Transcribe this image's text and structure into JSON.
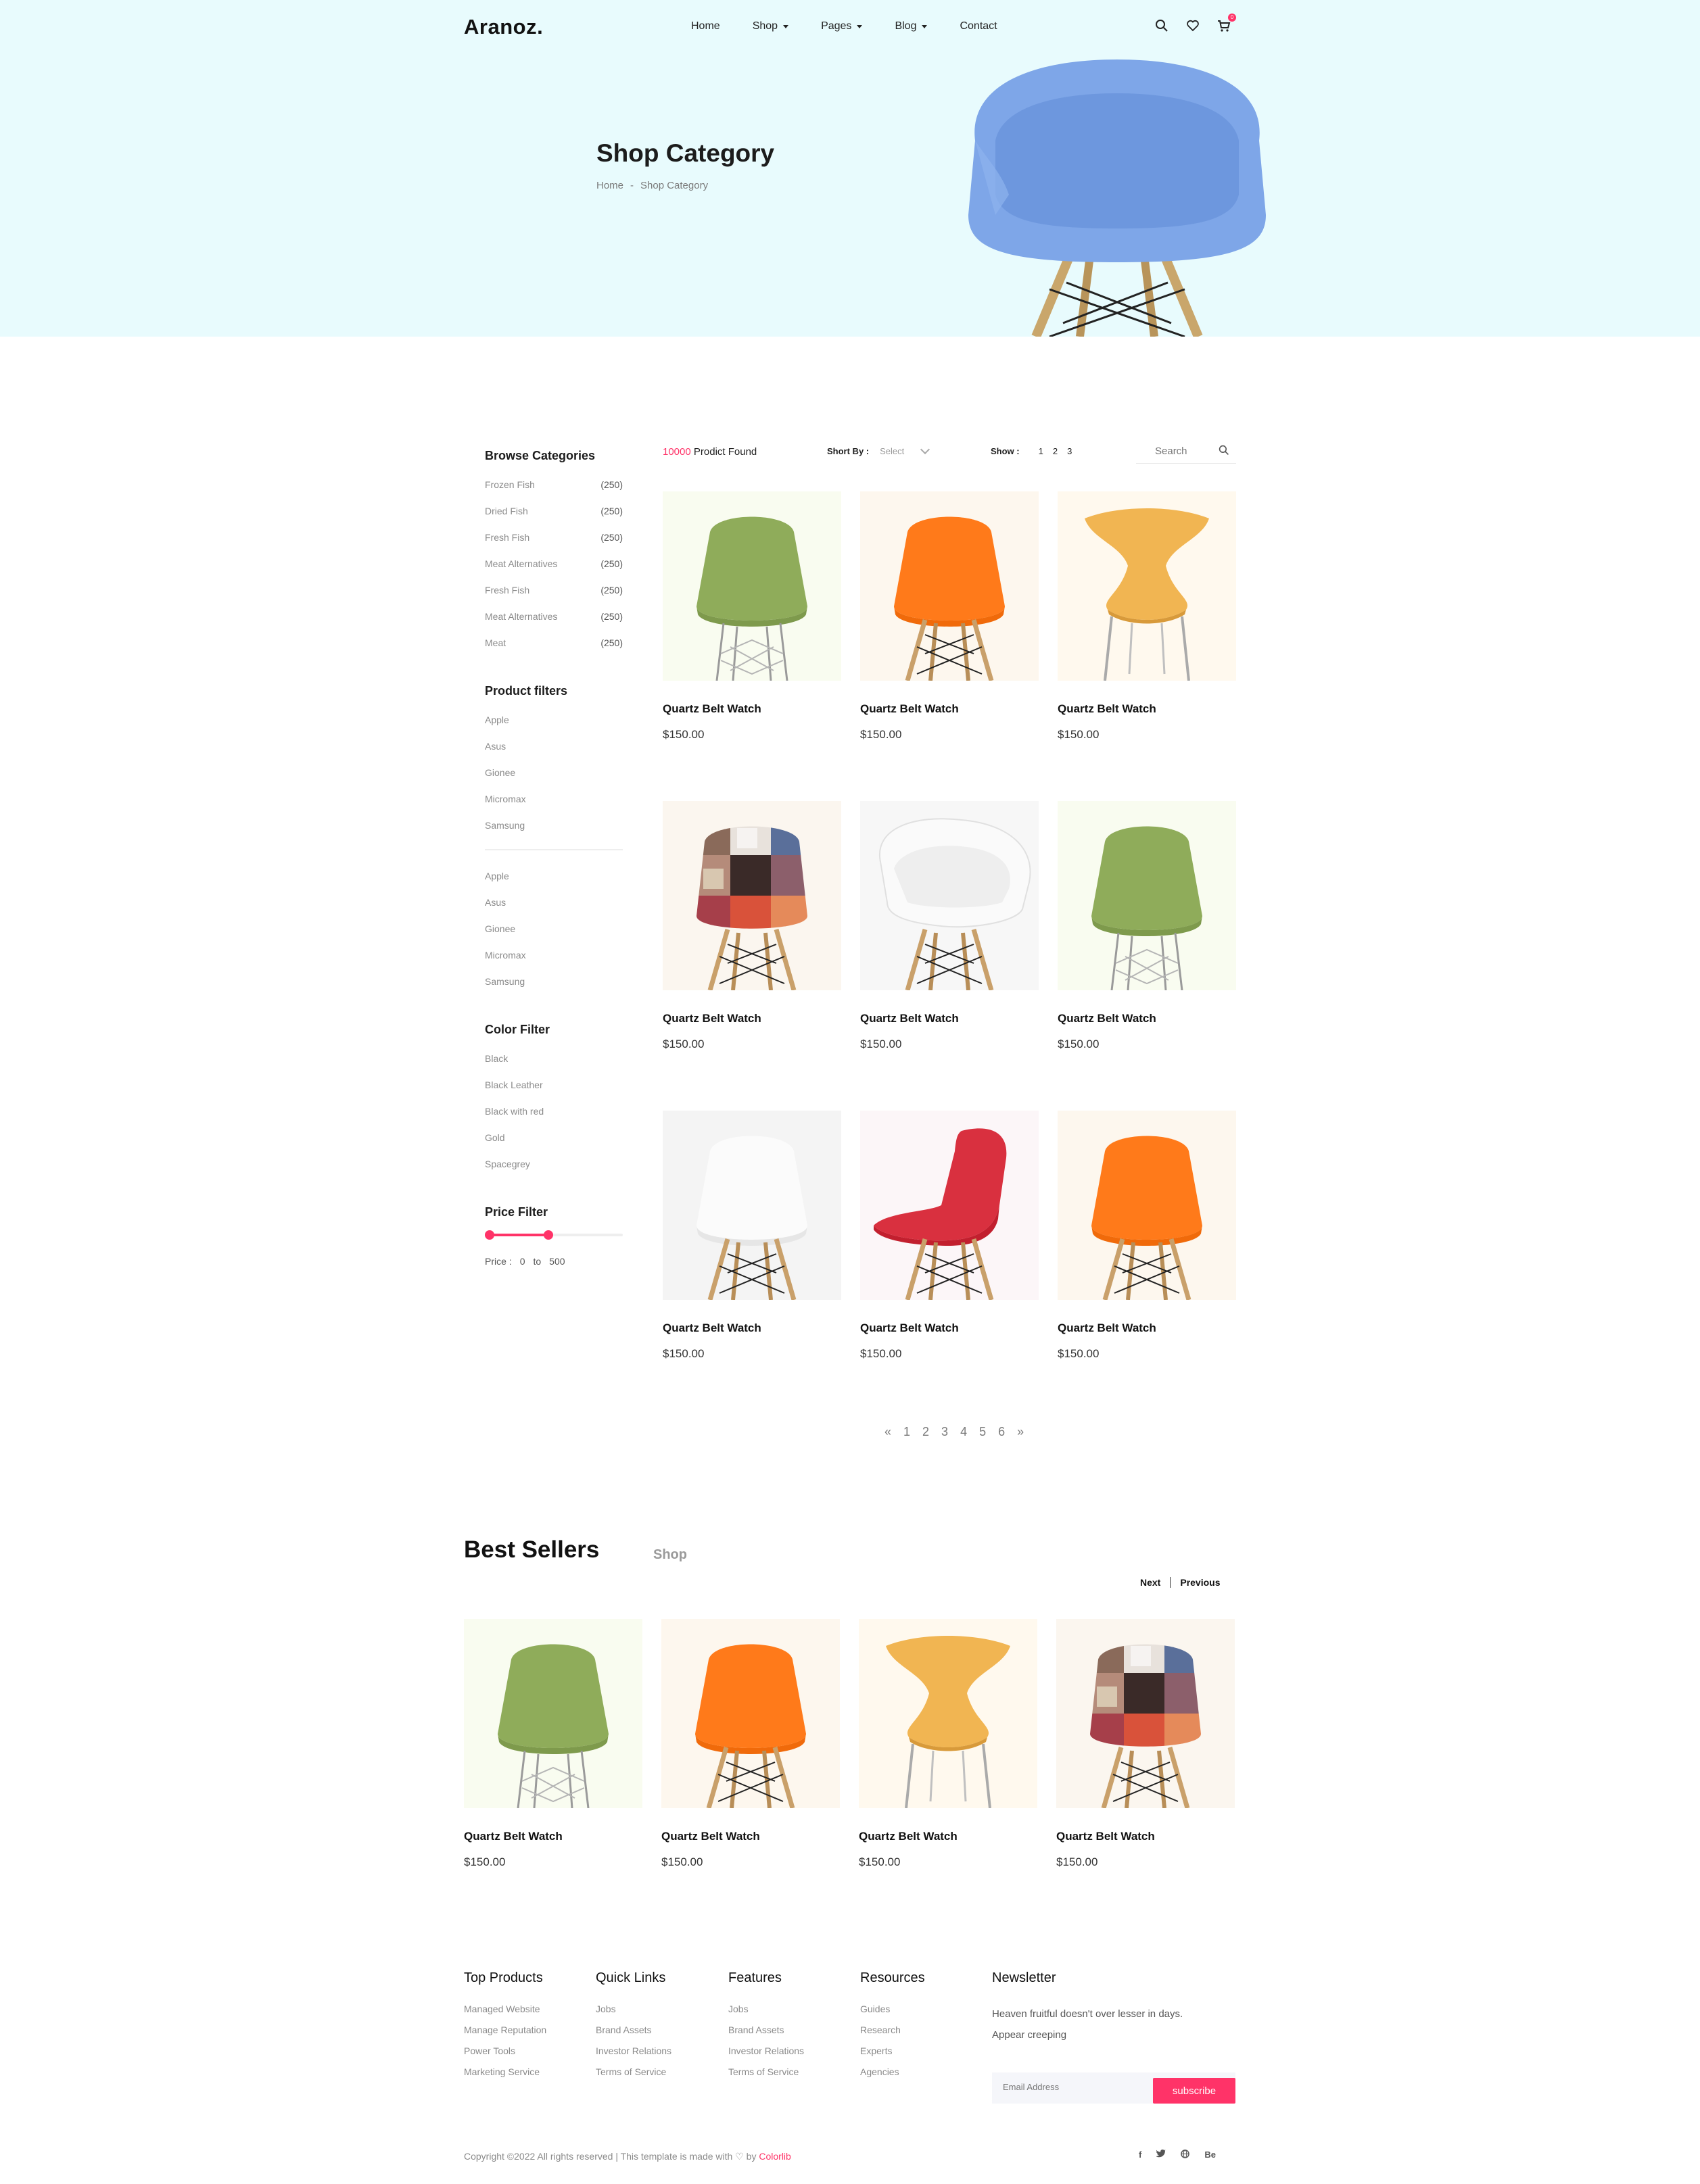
{
  "header": {
    "logo": "Aranoz.",
    "nav": [
      {
        "label": "Home",
        "dropdown": false
      },
      {
        "label": "Shop",
        "dropdown": true
      },
      {
        "label": "Pages",
        "dropdown": true
      },
      {
        "label": "Blog",
        "dropdown": true
      },
      {
        "label": "Contact",
        "dropdown": false
      }
    ],
    "cart_count": "0"
  },
  "hero": {
    "title": "Shop Category",
    "breadcrumb": [
      "Home",
      "-",
      "Shop Category"
    ]
  },
  "sidebar": {
    "categories_title": "Browse Categories",
    "categories": [
      {
        "label": "Frozen Fish",
        "count": "(250)"
      },
      {
        "label": "Dried Fish",
        "count": "(250)"
      },
      {
        "label": "Fresh Fish",
        "count": "(250)"
      },
      {
        "label": "Meat Alternatives",
        "count": "(250)"
      },
      {
        "label": "Fresh Fish",
        "count": "(250)"
      },
      {
        "label": "Meat Alternatives",
        "count": "(250)"
      },
      {
        "label": "Meat",
        "count": "(250)"
      }
    ],
    "filters_title": "Product filters",
    "filters_a": [
      "Apple",
      "Asus",
      "Gionee",
      "Micromax",
      "Samsung"
    ],
    "filters_b": [
      "Apple",
      "Asus",
      "Gionee",
      "Micromax",
      "Samsung"
    ],
    "color_title": "Color Filter",
    "colors": [
      "Black",
      "Black Leather",
      "Black with red",
      "Gold",
      "Spacegrey"
    ],
    "price_title": "Price Filter",
    "price_label": "Price :",
    "price_from": "0",
    "price_to_label": "to",
    "price_to": "500",
    "price_range_fraction": [
      0.0,
      0.46
    ]
  },
  "toolbar": {
    "found_count": "10000",
    "found_text": "Prodict Found",
    "sort_label": "Short By :",
    "sort_value": "Select",
    "show_label": "Show :",
    "show_options": [
      "1",
      "2",
      "3"
    ],
    "search_placeholder": "Search"
  },
  "products": [
    {
      "name": "Quartz Belt Watch",
      "price": "$150.00",
      "chair": "green"
    },
    {
      "name": "Quartz Belt Watch",
      "price": "$150.00",
      "chair": "orange"
    },
    {
      "name": "Quartz Belt Watch",
      "price": "$150.00",
      "chair": "yellow-butterfly"
    },
    {
      "name": "Quartz Belt Watch",
      "price": "$150.00",
      "chair": "patchwork"
    },
    {
      "name": "Quartz Belt Watch",
      "price": "$150.00",
      "chair": "white-armchair"
    },
    {
      "name": "Quartz Belt Watch",
      "price": "$150.00",
      "chair": "green"
    },
    {
      "name": "Quartz Belt Watch",
      "price": "$150.00",
      "chair": "white"
    },
    {
      "name": "Quartz Belt Watch",
      "price": "$150.00",
      "chair": "red"
    },
    {
      "name": "Quartz Belt Watch",
      "price": "$150.00",
      "chair": "orange"
    }
  ],
  "pagination": [
    "«",
    "1",
    "2",
    "3",
    "4",
    "5",
    "6",
    "»"
  ],
  "best_sellers": {
    "title": "Best Sellers",
    "subtitle": "Shop",
    "next": "Next",
    "previous": "Previous",
    "items": [
      {
        "name": "Quartz Belt Watch",
        "price": "$150.00",
        "chair": "green"
      },
      {
        "name": "Quartz Belt Watch",
        "price": "$150.00",
        "chair": "orange"
      },
      {
        "name": "Quartz Belt Watch",
        "price": "$150.00",
        "chair": "yellow-butterfly"
      },
      {
        "name": "Quartz Belt Watch",
        "price": "$150.00",
        "chair": "patchwork"
      }
    ]
  },
  "footer": {
    "columns": [
      {
        "title": "Top Products",
        "links": [
          "Managed Website",
          "Manage Reputation",
          "Power Tools",
          "Marketing Service"
        ]
      },
      {
        "title": "Quick Links",
        "links": [
          "Jobs",
          "Brand Assets",
          "Investor Relations",
          "Terms of Service"
        ]
      },
      {
        "title": "Features",
        "links": [
          "Jobs",
          "Brand Assets",
          "Investor Relations",
          "Terms of Service"
        ]
      },
      {
        "title": "Resources",
        "links": [
          "Guides",
          "Research",
          "Experts",
          "Agencies"
        ]
      }
    ],
    "newsletter_title": "Newsletter",
    "newsletter_text": "Heaven fruitful doesn't over lesser in days. Appear creeping",
    "email_placeholder": "Email Address",
    "subscribe_label": "subscribe",
    "copyright_prefix": "Copyright ©2022 All rights reserved | This template is made with",
    "copyright_by": "by",
    "copyright_brand": "Colorlib",
    "socials": [
      "f",
      "t",
      "g",
      "Be"
    ]
  },
  "colors": {
    "accent": "#ff3368",
    "hero_bg": "#e8fbfd",
    "text_dark": "#111111",
    "text_muted": "#8a8a8a"
  }
}
